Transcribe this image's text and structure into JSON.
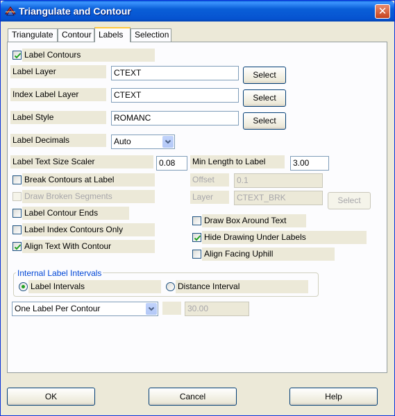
{
  "window": {
    "title": "Triangulate and Contour",
    "close_label": "✕"
  },
  "tabs": [
    {
      "label": "Triangulate"
    },
    {
      "label": "Contour"
    },
    {
      "label": "Labels",
      "active": true
    },
    {
      "label": "Selection"
    }
  ],
  "labels_tab": {
    "label_contours": {
      "label": "Label Contours",
      "checked": true
    },
    "label_layer": {
      "label": "Label Layer",
      "value": "CTEXT",
      "button": "Select"
    },
    "index_label_layer": {
      "label": "Index Label Layer",
      "value": "CTEXT",
      "button": "Select"
    },
    "label_style": {
      "label": "Label Style",
      "value": "ROMANC",
      "button": "Select"
    },
    "label_decimals": {
      "label": "Label Decimals",
      "value": "Auto"
    },
    "text_size_scaler": {
      "label": "Label Text Size Scaler",
      "value": "0.08"
    },
    "min_length": {
      "label": "Min Length to Label",
      "value": "3.00"
    },
    "break_contours": {
      "label": "Break Contours at Label",
      "checked": false
    },
    "offset": {
      "label": "Offset",
      "value": "0.1"
    },
    "draw_broken": {
      "label": "Draw Broken Segments",
      "checked": false
    },
    "layer": {
      "label": "Layer",
      "value": "CTEXT_BRK",
      "button": "Select"
    },
    "label_contour_ends": {
      "label": "Label Contour Ends",
      "checked": false
    },
    "draw_box": {
      "label": "Draw Box Around Text",
      "checked": false
    },
    "label_index_only": {
      "label": "Label Index Contours Only",
      "checked": false
    },
    "hide_drawing": {
      "label": "Hide Drawing Under Labels",
      "checked": true
    },
    "align_text": {
      "label": "Align Text With Contour",
      "checked": true
    },
    "align_uphill": {
      "label": "Align Facing Uphill",
      "checked": false
    }
  },
  "intervals_group": {
    "title": "Internal Label Intervals",
    "label_intervals": {
      "label": "Label Intervals",
      "selected": true
    },
    "distance_interval": {
      "label": "Distance Interval",
      "selected": false
    },
    "mode": "One Label Per Contour",
    "distance_value": "30.00"
  },
  "footer": {
    "ok": "OK",
    "cancel": "Cancel",
    "help": "Help"
  },
  "colors": {
    "titlebar": "#0a5fd8",
    "face": "#ece9d8",
    "panel": "#fcfcfe",
    "check": "#21a121",
    "group_title": "#0046d5"
  }
}
